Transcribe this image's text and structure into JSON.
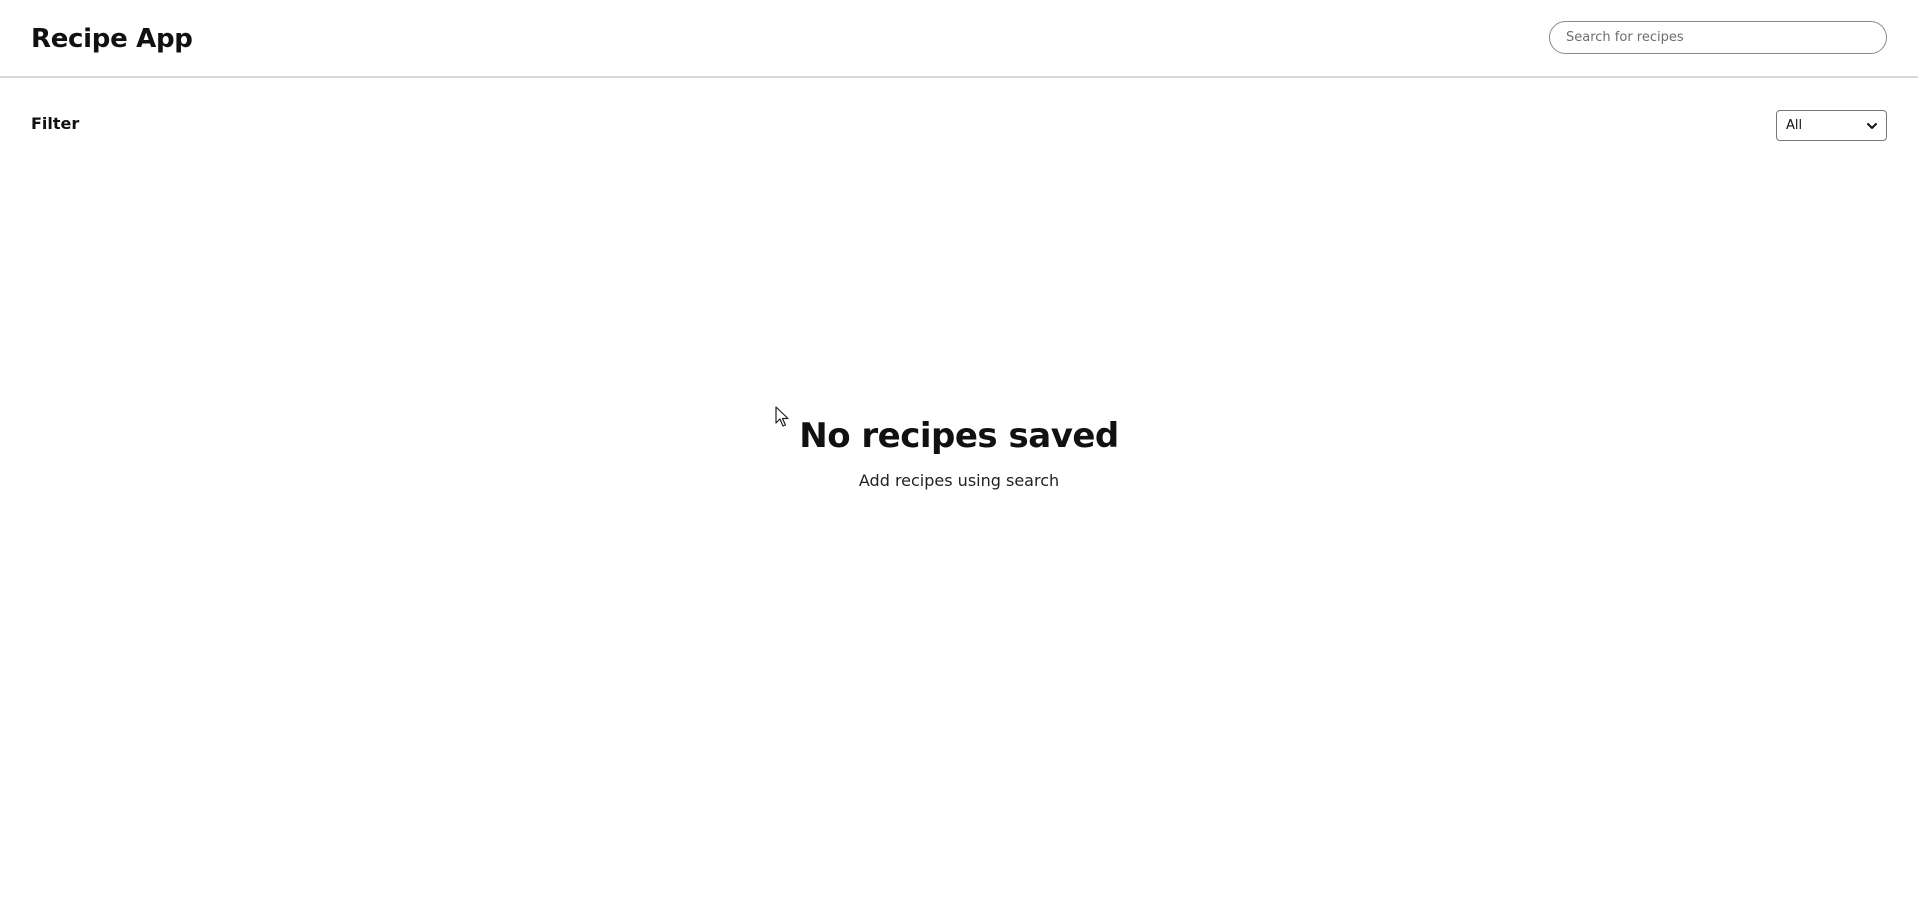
{
  "header": {
    "title": "Recipe App",
    "search_placeholder": "Search for recipes"
  },
  "filter": {
    "label": "Filter",
    "selected": "All",
    "chevron_icon": "chevron-down-icon"
  },
  "empty_state": {
    "title": "No recipes saved",
    "subtitle": "Add recipes using search"
  },
  "colors": {
    "background": "#ffffff",
    "text": "#111111",
    "divider": "#d9d9d9",
    "input_border": "#8a8a8a"
  },
  "cursor_icon": "mouse-pointer-icon"
}
